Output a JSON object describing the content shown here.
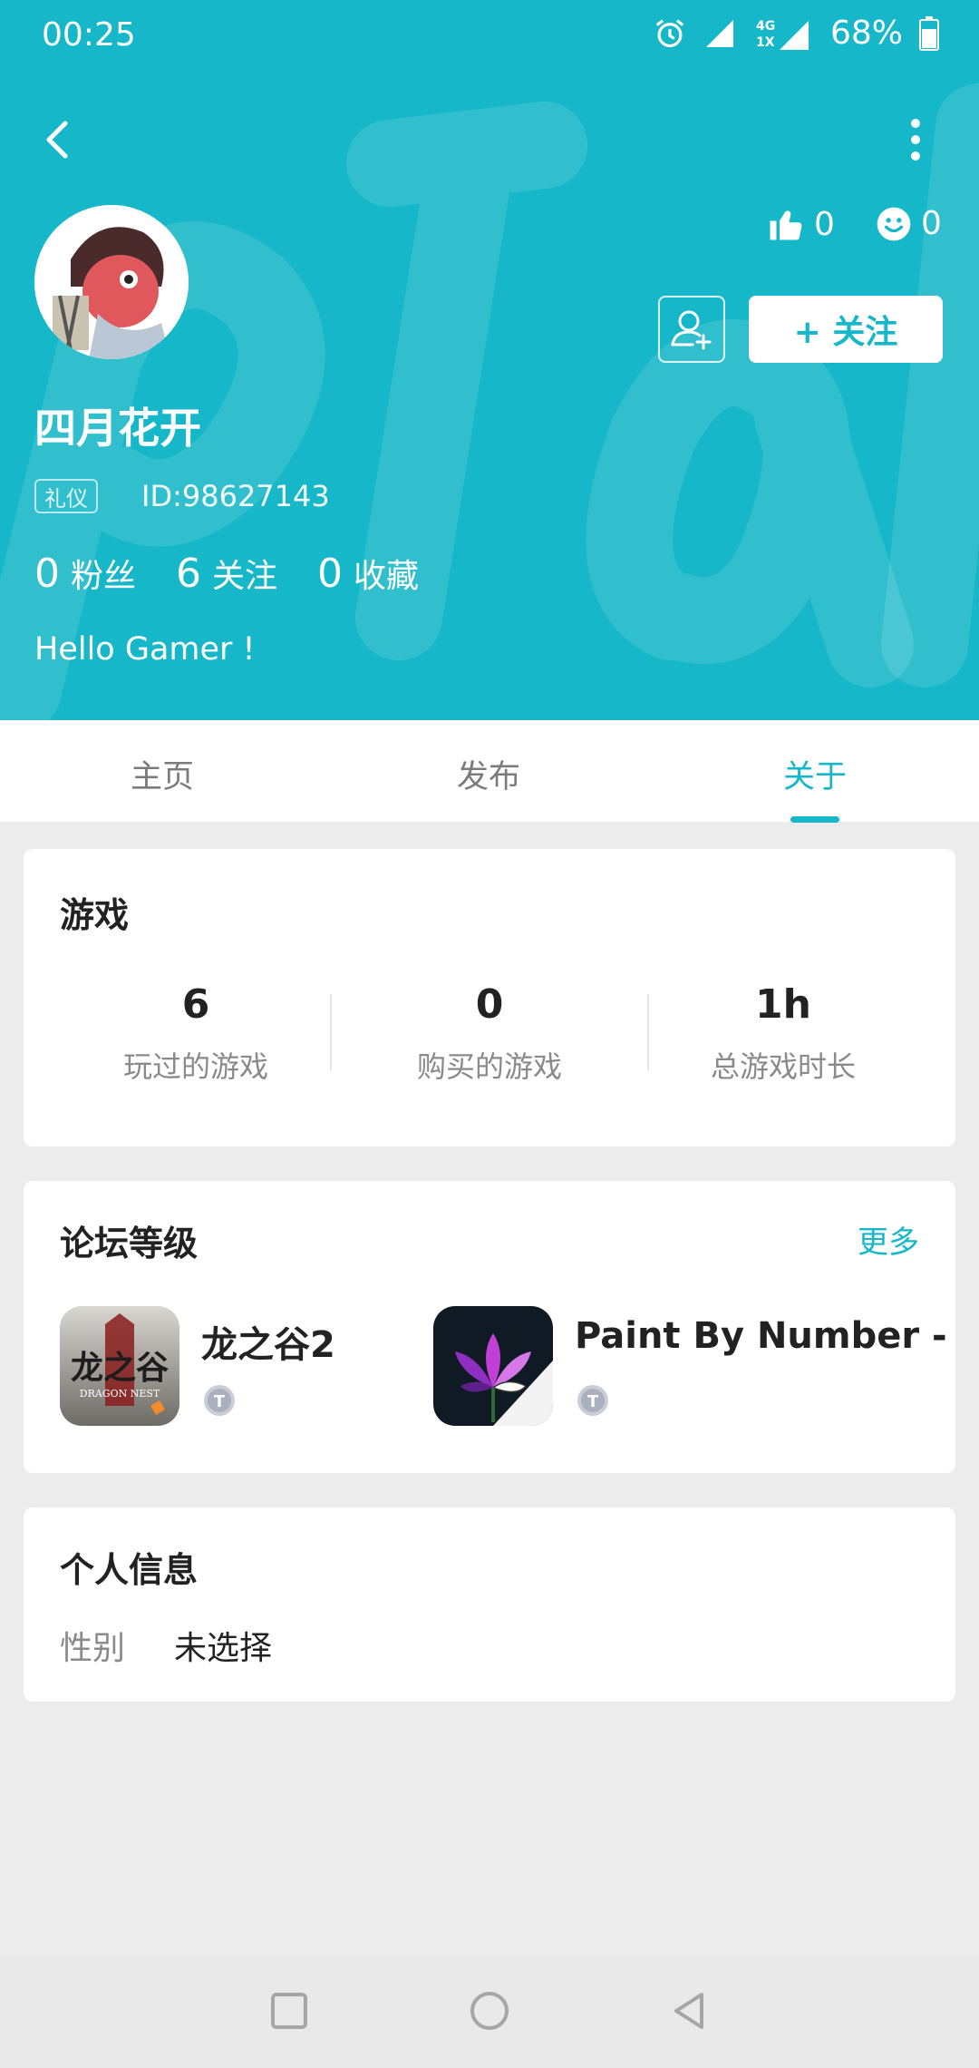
{
  "status": {
    "time": "00:25",
    "network": "4G 1X",
    "battery": "68%"
  },
  "header": {
    "username": "四月花开",
    "tag": "礼仪",
    "user_id": "ID:98627143",
    "likes": "0",
    "smiles": "0",
    "follow_label": "+ 关注",
    "stats": [
      {
        "num": "0",
        "label": "粉丝"
      },
      {
        "num": "6",
        "label": "关注"
      },
      {
        "num": "0",
        "label": "收藏"
      }
    ],
    "bio": "Hello Gamer !",
    "icons": [
      "back-arrow-icon",
      "more-vert-icon",
      "thumbs-up-icon",
      "smiley-icon",
      "add-friend-icon"
    ]
  },
  "tabs": [
    {
      "label": "主页"
    },
    {
      "label": "发布"
    },
    {
      "label": "关于",
      "active": true
    }
  ],
  "games": {
    "title": "游戏",
    "stats": [
      {
        "value": "6",
        "label": "玩过的游戏"
      },
      {
        "value": "0",
        "label": "购买的游戏"
      },
      {
        "value": "1h",
        "label": "总游戏时长"
      }
    ]
  },
  "forum": {
    "title": "论坛等级",
    "more": "更多",
    "items": [
      {
        "name": "龙之谷2",
        "icon_text": "龙之谷",
        "icon_subtext": "DRAGON NEST"
      },
      {
        "name": "Paint By Number - Free"
      }
    ]
  },
  "personal": {
    "title": "个人信息",
    "label": "性别",
    "value": "未选择"
  },
  "colors": {
    "accent": "#15b7c8",
    "background": "#ececec"
  }
}
